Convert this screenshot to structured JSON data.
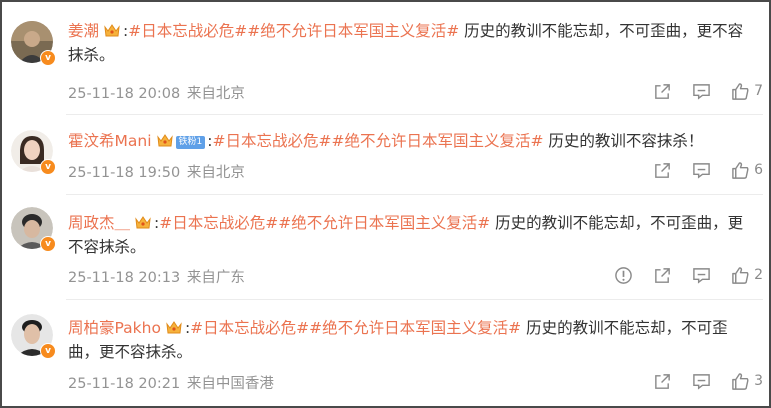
{
  "comments": [
    {
      "username": "姜潮",
      "fan_badge": "",
      "topic1": "#日本忘战必危#",
      "topic2": "#绝不允许日本军国主义复活#",
      "text": " 历史的教训不能忘却，不可歪曲，更不容抹杀。",
      "time": "25-11-18 20:08",
      "location": "来自北京",
      "likes": "7",
      "has_report": false
    },
    {
      "username": "霍汶希Mani",
      "fan_badge": "铁粉1",
      "topic1": "#日本忘战必危#",
      "topic2": "#绝不允许日本军国主义复活#",
      "text": " 历史的教训不容抹杀！",
      "time": "25-11-18 19:50",
      "location": "来自北京",
      "likes": "6",
      "has_report": false
    },
    {
      "username": "周政杰＿",
      "fan_badge": "",
      "topic1": "#日本忘战必危#",
      "topic2": "#绝不允许日本军国主义复活#",
      "text": " 历史的教训不能忘却，不可歪曲，更不容抹杀。",
      "time": "25-11-18 20:13",
      "location": "来自广东",
      "likes": "2",
      "has_report": true
    },
    {
      "username": "周柏豪Pakho",
      "fan_badge": "",
      "topic1": "#日本忘战必危#",
      "topic2": "#绝不允许日本军国主义复活#",
      "text": " 历史的教训不能忘却，不可歪曲，更不容抹杀。",
      "time": "25-11-18 20:21",
      "location": "来自中国香港",
      "likes": "3",
      "has_report": false
    }
  ],
  "colors": {
    "username": "#eb7350",
    "topic": "#eb7350",
    "meta": "#939393",
    "verified_badge": "#f78b1e"
  },
  "icons": [
    "share-icon",
    "comment-icon",
    "like-icon",
    "report-icon",
    "crown-icon",
    "verified-badge-icon"
  ]
}
